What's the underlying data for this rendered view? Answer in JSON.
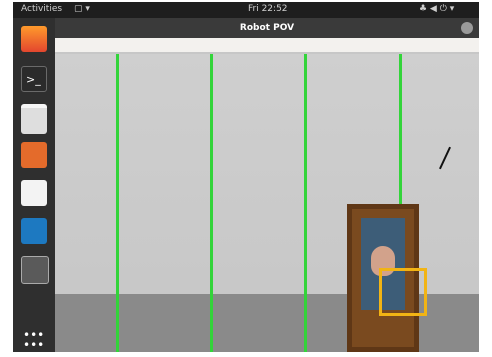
{
  "topbar": {
    "activities": "Activities",
    "clock": "Fri 22:52"
  },
  "window": {
    "title": "Robot POV"
  },
  "dock": {
    "apps": [
      {
        "name": "firefox",
        "icon": "firefox-icon"
      },
      {
        "name": "terminal",
        "icon": "terminal-icon"
      },
      {
        "name": "files",
        "icon": "folder-icon"
      },
      {
        "name": "installer",
        "icon": "package-icon"
      },
      {
        "name": "editor",
        "icon": "text-editor-icon"
      },
      {
        "name": "vscode",
        "icon": "vscode-icon"
      },
      {
        "name": "robot-app",
        "icon": "robot-app-icon"
      }
    ],
    "grid_icon": "apps-grid-icon"
  },
  "colors": {
    "gridline": "#33d43a",
    "bbox": "#f2b414"
  }
}
